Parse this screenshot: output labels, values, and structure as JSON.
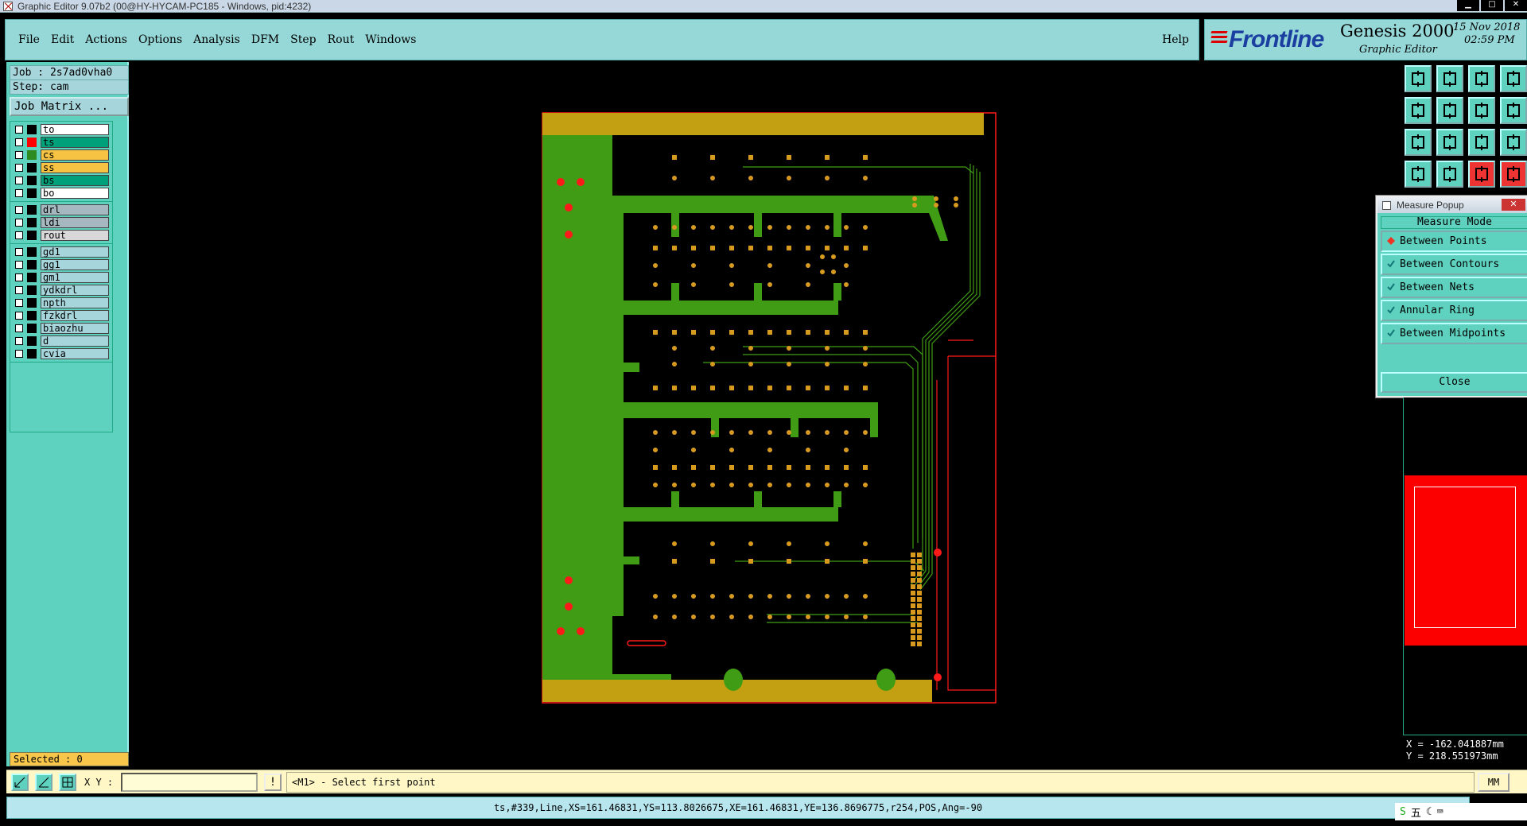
{
  "window": {
    "title": "Graphic Editor 9.07b2 (00@HY-HYCAM-PC185 - Windows, pid:4232)",
    "controls": [
      "▁",
      "□",
      "✕"
    ]
  },
  "menu": {
    "items": [
      "File",
      "Edit",
      "Actions",
      "Options",
      "Analysis",
      "DFM",
      "Step",
      "Rout",
      "Windows"
    ],
    "help": "Help"
  },
  "brand": {
    "logo": "Frontline",
    "product": "Genesis 2000",
    "subtitle": "Graphic Editor",
    "date": "15 Nov 2018",
    "time": "02:59 PM"
  },
  "job": {
    "job_label": "Job : 2s7ad0vha0",
    "step_label": "Step: cam",
    "matrix_button": "Job Matrix ..."
  },
  "layers": {
    "group1": [
      {
        "name": "to",
        "color": "#ffffff",
        "swatch": "#000000"
      },
      {
        "name": "ts",
        "color": "#00a07a",
        "swatch": "#ff0000"
      },
      {
        "name": "cs",
        "color": "#f6c342",
        "swatch": "#2e8b22"
      },
      {
        "name": "ss",
        "color": "#f6c342",
        "swatch": "#000000"
      },
      {
        "name": "bs",
        "color": "#00a07a",
        "swatch": "#000000"
      },
      {
        "name": "bo",
        "color": "#ffffff",
        "swatch": "#000000"
      }
    ],
    "group2": [
      {
        "name": "drl",
        "color": "#a6b8bf",
        "swatch": "#000000"
      },
      {
        "name": "ldi",
        "color": "#a6b8bf",
        "swatch": "#000000"
      },
      {
        "name": "rout",
        "color": "#d8d8d8",
        "swatch": "#000000"
      }
    ],
    "group3": [
      {
        "name": "gd1",
        "color": "#a6d6dc",
        "swatch": "#000000"
      },
      {
        "name": "gg1",
        "color": "#a6d6dc",
        "swatch": "#000000"
      },
      {
        "name": "gm1",
        "color": "#a6d6dc",
        "swatch": "#000000"
      },
      {
        "name": "ydkdrl",
        "color": "#a6d6dc",
        "swatch": "#000000"
      },
      {
        "name": "npth",
        "color": "#a6d6dc",
        "swatch": "#000000"
      },
      {
        "name": "fzkdrl",
        "color": "#a6d6dc",
        "swatch": "#000000"
      },
      {
        "name": "biaozhu",
        "color": "#a6d6dc",
        "swatch": "#000000"
      },
      {
        "name": "d",
        "color": "#a6d6dc",
        "swatch": "#000000"
      },
      {
        "name": "cvia",
        "color": "#a6d6dc",
        "swatch": "#000000"
      }
    ]
  },
  "selected": "Selected : 0",
  "measure_popup": {
    "title": "Measure Popup",
    "mode_title": "Measure Mode",
    "options": [
      "Between Points",
      "Between Contours",
      "Between Nets",
      "Annular Ring",
      "Between Midpoints"
    ],
    "active_option": "Between Points",
    "close": "Close"
  },
  "coords": {
    "x": "X = -162.041887mm",
    "y": "Y = 218.551973mm"
  },
  "bottom": {
    "xy_label": "X Y :",
    "xy_value": "",
    "prompt": "<M1> - Select first point",
    "units": "MM",
    "status": "ts,#339,Line,XS=161.46831,YS=113.8026675,XE=161.46831,YE=136.8696775,r254,POS,Ang=-90",
    "tray_text": "五"
  },
  "colors": {
    "panel_teal": "#5fd1bf",
    "menu_cyan": "#96d8d8",
    "copper_green": "#3f9c14",
    "pad_orange": "#d79a1f",
    "outline_red": "#ff1a1a"
  }
}
